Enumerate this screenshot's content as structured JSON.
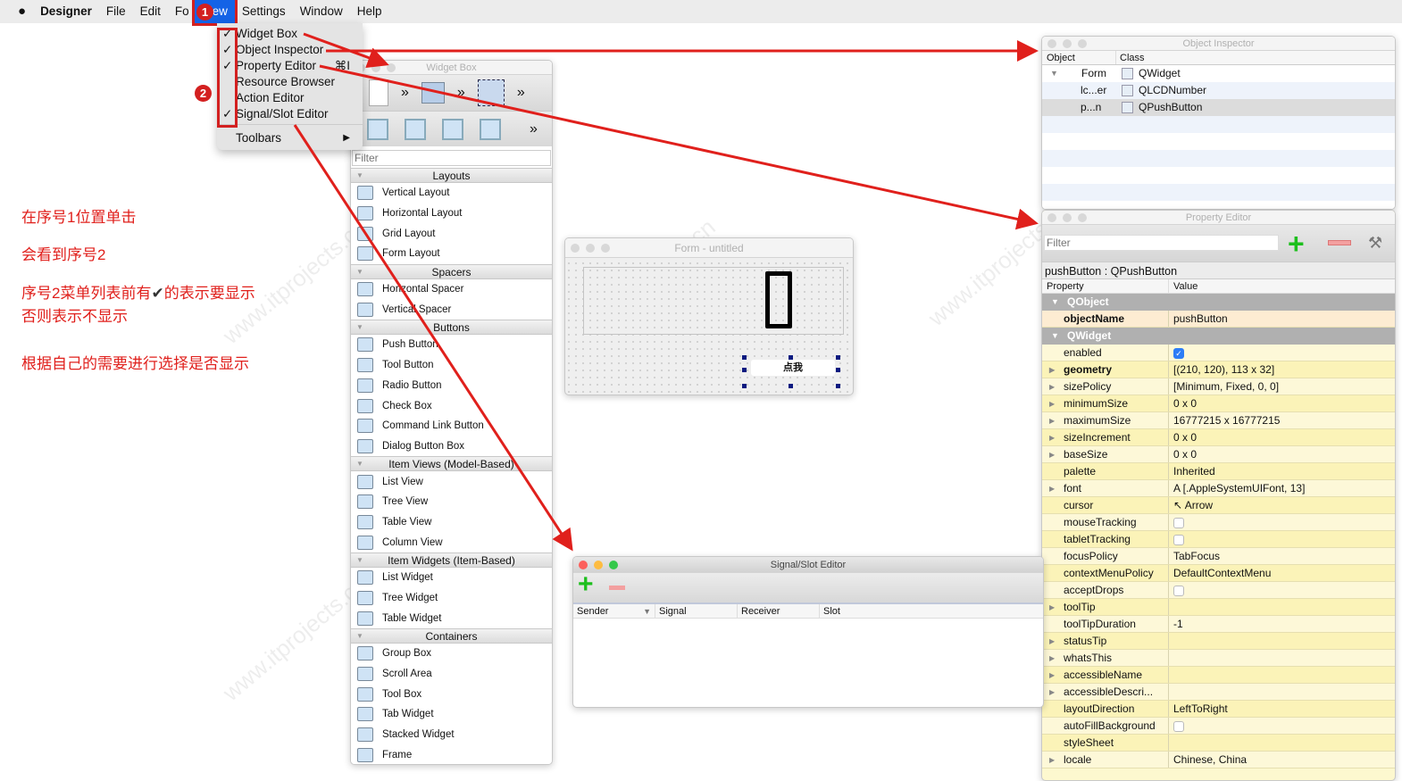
{
  "menubar": {
    "apple": "",
    "app": "Designer",
    "items": [
      "File",
      "Edit",
      "Fo",
      "View",
      "Settings",
      "Window",
      "Help"
    ]
  },
  "view_menu": {
    "items": [
      {
        "label": "Widget Box",
        "checked": true,
        "shortcut": ""
      },
      {
        "label": "Object Inspector",
        "checked": true,
        "shortcut": ""
      },
      {
        "label": "Property Editor",
        "checked": true,
        "shortcut": "⌘I"
      },
      {
        "label": "Resource Browser",
        "checked": false,
        "shortcut": ""
      },
      {
        "label": "Action Editor",
        "checked": false,
        "shortcut": ""
      },
      {
        "label": "Signal/Slot Editor",
        "checked": true,
        "shortcut": ""
      }
    ],
    "toolbars": "Toolbars",
    "check": "✓",
    "submenu_arrow": "▶"
  },
  "badges": {
    "one": "1",
    "two": "2"
  },
  "annotations": {
    "line1": "在序号1位置单击",
    "line2": "会看到序号2",
    "line3a": "序号2菜单列表前有",
    "line3b": "的表示要显示",
    "line4": "否则表示不显示",
    "line5": "根据自己的需要进行选择是否显示",
    "check": "✔"
  },
  "widget_box": {
    "title": "Widget Box",
    "filter_placeholder": "Filter",
    "more": "»",
    "categories": [
      {
        "name": "Layouts",
        "items": [
          "Vertical Layout",
          "Horizontal Layout",
          "Grid Layout",
          "Form Layout"
        ]
      },
      {
        "name": "Spacers",
        "items": [
          "Horizontal Spacer",
          "Vertical Spacer"
        ]
      },
      {
        "name": "Buttons",
        "items": [
          "Push Button",
          "Tool Button",
          "Radio Button",
          "Check Box",
          "Command Link Button",
          "Dialog Button Box"
        ]
      },
      {
        "name": "Item Views (Model-Based)",
        "items": [
          "List View",
          "Tree View",
          "Table View",
          "Column View"
        ]
      },
      {
        "name": "Item Widgets (Item-Based)",
        "items": [
          "List Widget",
          "Tree Widget",
          "Table Widget"
        ]
      },
      {
        "name": "Containers",
        "items": [
          "Group Box",
          "Scroll Area",
          "Tool Box",
          "Tab Widget",
          "Stacked Widget",
          "Frame"
        ]
      }
    ]
  },
  "form": {
    "title": "Form - untitled",
    "lcd_value": "0",
    "button_label": "点我"
  },
  "object_inspector": {
    "title": "Object Inspector",
    "headers": [
      "Object",
      "Class"
    ],
    "rows": [
      {
        "object": "Form",
        "class": "QWidget"
      },
      {
        "object": "lc...er",
        "class": "QLCDNumber"
      },
      {
        "object": "p...n",
        "class": "QPushButton"
      }
    ]
  },
  "property_editor": {
    "title": "Property Editor",
    "filter_placeholder": "Filter",
    "object_label": "pushButton : QPushButton",
    "headers": [
      "Property",
      "Value"
    ],
    "groups": [
      {
        "name": "QObject",
        "rows": [
          {
            "name": "objectName",
            "value": "pushButton",
            "bold": true
          }
        ]
      },
      {
        "name": "QWidget",
        "rows": [
          {
            "name": "enabled",
            "check": true
          },
          {
            "name": "geometry",
            "value": "[(210, 120), 113 x 32]",
            "exp": true,
            "bold": true
          },
          {
            "name": "sizePolicy",
            "value": "[Minimum, Fixed, 0, 0]",
            "exp": true
          },
          {
            "name": "minimumSize",
            "value": "0 x 0",
            "exp": true
          },
          {
            "name": "maximumSize",
            "value": "16777215 x 16777215",
            "exp": true
          },
          {
            "name": "sizeIncrement",
            "value": "0 x 0",
            "exp": true
          },
          {
            "name": "baseSize",
            "value": "0 x 0",
            "exp": true
          },
          {
            "name": "palette",
            "value": "Inherited"
          },
          {
            "name": "font",
            "value": "A   [.AppleSystemUIFont, 13]",
            "exp": true
          },
          {
            "name": "cursor",
            "value": "↖  Arrow"
          },
          {
            "name": "mouseTracking",
            "check": false
          },
          {
            "name": "tabletTracking",
            "check": false
          },
          {
            "name": "focusPolicy",
            "value": "TabFocus"
          },
          {
            "name": "contextMenuPolicy",
            "value": "DefaultContextMenu"
          },
          {
            "name": "acceptDrops",
            "check": false
          },
          {
            "name": "toolTip",
            "value": "",
            "exp": true
          },
          {
            "name": "toolTipDuration",
            "value": "-1"
          },
          {
            "name": "statusTip",
            "value": "",
            "exp": true
          },
          {
            "name": "whatsThis",
            "value": "",
            "exp": true
          },
          {
            "name": "accessibleName",
            "value": "",
            "exp": true
          },
          {
            "name": "accessibleDescri...",
            "value": "",
            "exp": true
          },
          {
            "name": "layoutDirection",
            "value": "LeftToRight"
          },
          {
            "name": "autoFillBackground",
            "check": false
          },
          {
            "name": "styleSheet",
            "value": ""
          },
          {
            "name": "locale",
            "value": "Chinese, China",
            "exp": true
          }
        ]
      }
    ]
  },
  "signal_slot": {
    "title": "Signal/Slot Editor",
    "headers": [
      "Sender",
      "Signal",
      "Receiver",
      "Slot"
    ]
  },
  "watermark": "www.itprojects.cn",
  "colors": {
    "accent": "#1463e6",
    "annotation": "#e0201c",
    "property_row": "#fdf8cf",
    "group": "#b0b0b0"
  }
}
